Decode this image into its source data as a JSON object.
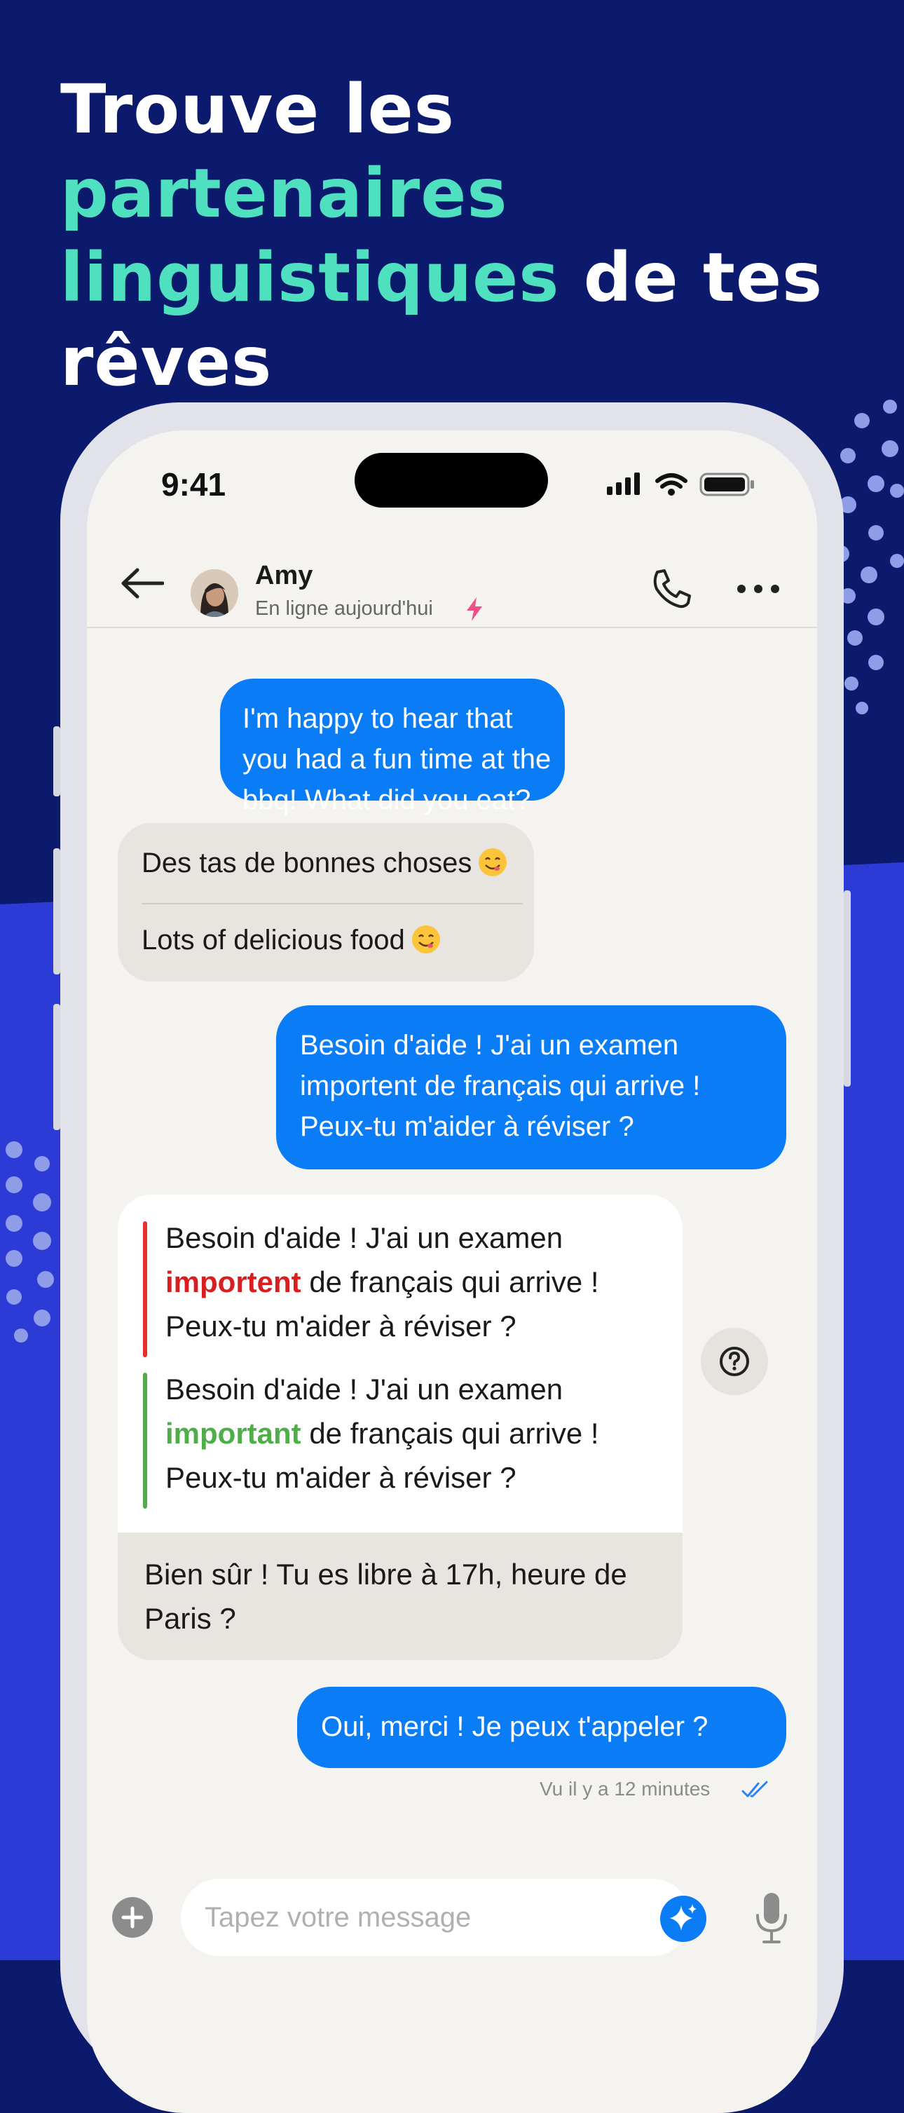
{
  "headline": {
    "part1": "Trouve les ",
    "accent1": "partenaires",
    "accent2": "linguistiques",
    "part2": " de tes rêves"
  },
  "status_bar": {
    "time": "9:41"
  },
  "chat_header": {
    "contact_name": "Amy",
    "contact_status": "En ligne aujourd'hui"
  },
  "messages": [
    {
      "direction": "out",
      "text": "I'm happy to hear that you had a fun time at the bbq! What did you eat?"
    },
    {
      "direction": "in",
      "text": "Des tas de bonnes choses",
      "translation": "Lots of delicious food"
    },
    {
      "direction": "out",
      "text": "Besoin d'aide ! J'ai un examen importent de français qui arrive ! Peux-tu m'aider à réviser ?"
    },
    {
      "direction": "in",
      "correction": {
        "original_before": "Besoin d'aide ! J'ai un examen ",
        "original_error": "importent",
        "original_after": " de français qui arrive ! Peux-tu m'aider à réviser ?",
        "corrected_before": "Besoin d'aide ! J'ai un examen ",
        "corrected_fix": "important",
        "corrected_after": " de français qui arrive ! Peux-tu m'aider à réviser ?"
      },
      "text": "Bien sûr ! Tu es libre à 17h, heure de Paris ?"
    },
    {
      "direction": "out",
      "text": "Oui, merci ! Je peux t'appeler ?"
    }
  ],
  "read_receipt": "Vu il y a 12 minutes",
  "composer": {
    "placeholder": "Tapez votre message"
  },
  "icons": {
    "back": "arrow-left-icon",
    "call": "phone-icon",
    "more": "more-horizontal-icon",
    "help": "question-circle-icon",
    "add": "plus-circle-icon",
    "ai": "sparkle-icon",
    "mic": "microphone-icon"
  },
  "colors": {
    "background_top": "#0c1a6e",
    "background_bottom": "#2d3bd6",
    "accent": "#4fe0c0",
    "outgoing_bubble": "#0a7cf5",
    "incoming_bubble": "#e8e5e1",
    "error": "#d81e1e",
    "correct": "#4fae4a"
  }
}
